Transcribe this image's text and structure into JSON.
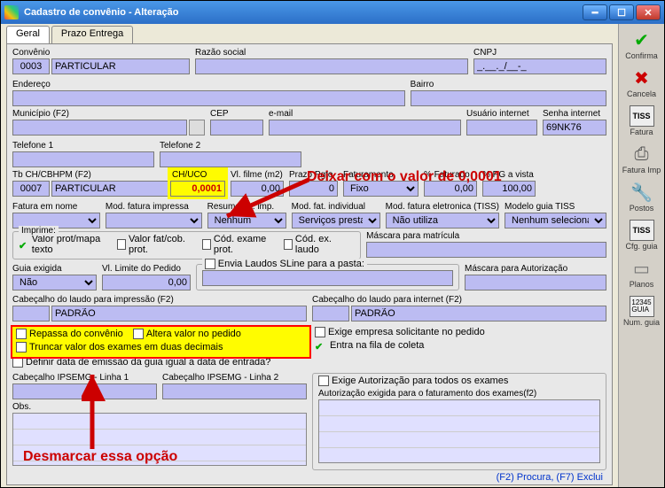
{
  "window": {
    "title": "Cadastro de convênio - Alteração"
  },
  "tabs": {
    "geral": "Geral",
    "prazo": "Prazo Entrega"
  },
  "labels": {
    "convenio": "Convênio",
    "razao": "Razão social",
    "cnpj": "CNPJ",
    "endereco": "Endereço",
    "bairro": "Bairro",
    "municipio": "Município (F2)",
    "cep": "CEP",
    "email": "e-mail",
    "usuario_net": "Usuário internet",
    "senha_net": "Senha internet",
    "tel1": "Telefone 1",
    "tel2": "Telefone 2",
    "tbch": "Tb CH/CBHPM (F2)",
    "chuco": "CH/UCO",
    "vlfilme": "Vl. filme (m2)",
    "prazo_pgto": "Prazo Pgto",
    "faturamento": "Faturamento",
    "pct_fat": "% Faturado",
    "pct_pg": "% PG a vista",
    "fat_nome": "Fatura em nome",
    "mod_fat_imp": "Mod. fatura impressa",
    "resumo": "Resumo fat. imp.",
    "mod_fat_ind": "Mod. fat. individual",
    "mod_tiss": "Mod. fatura eletronica (TISS)",
    "modelo_guia": "Modelo guia TISS",
    "imprime": "Imprime:",
    "valor_prot": "Valor prot/mapa texto",
    "valor_fat": "Valor fat/cob. prot.",
    "cod_exame": "Cód. exame prot.",
    "cod_ex_laudo": "Cód. ex. laudo",
    "masc_mat": "Máscara para matrícula",
    "guia_exig": "Guia exigida",
    "vl_limite": "Vl. Limite do Pedido",
    "envia_laudos": "Envia Laudos SLine para a pasta:",
    "masc_auth": "Máscara para Autorização",
    "cab_imp": "Cabeçalho do laudo para impressão (F2)",
    "cab_net": "Cabeçalho do laudo para internet (F2)",
    "repassa": "Repassa do convênio",
    "altera_valor": "Altera valor no pedido",
    "truncar": "Truncar valor dos exames em duas decimais",
    "definir_data": "Definir data de emissão da guia igual a data de entrada?",
    "exige_emp": "Exige empresa solicitante no pedido",
    "entra_fila": "Entra na fila de coleta",
    "exige_auth": "Exige Autorização para todos os exames",
    "auth_exig": "Autorização exigida para o faturamento dos exames(f2)",
    "cab_ips1": "Cabeçalho IPSEMG - Linha 1",
    "cab_ips2": "Cabeçalho IPSEMG - Linha 2",
    "obs": "Obs."
  },
  "values": {
    "conv_cod": "0003",
    "conv_nome": "PARTICULAR",
    "cnpj": "_.__._/__-_",
    "senha_net": "69NK76",
    "tbch_cod": "0007",
    "tbch_nome": "PARTICULAR",
    "chuco": "0,0001",
    "vlfilme": "0,00",
    "prazo_pgto": "0",
    "faturamento": "Fixo",
    "pct_fat": "0,00",
    "pct_pg": "100,00",
    "resumo": "Nenhum",
    "mod_fat_ind": "Serviços prestad",
    "mod_tiss": "Não utiliza",
    "modelo_guia": "Nenhum selecionado",
    "guia_exig": "Não",
    "vl_limite": "0,00",
    "cab_imp": "PADRÃO",
    "cab_net": "PADRÃO"
  },
  "sidebar": {
    "confirma": "Confirma",
    "cancela": "Cancela",
    "fatura": "Fatura",
    "fatura_imp": "Fatura Imp",
    "postos": "Postos",
    "cfg_guia": "Cfg. guia",
    "planos": "Planos",
    "num_guia": "Num. guia"
  },
  "annotations": {
    "a1": "Deixar com o valor de 0,0001",
    "a2": "Desmarcar essa opção"
  },
  "footer": "(F2) Procura, (F7) Exclui"
}
